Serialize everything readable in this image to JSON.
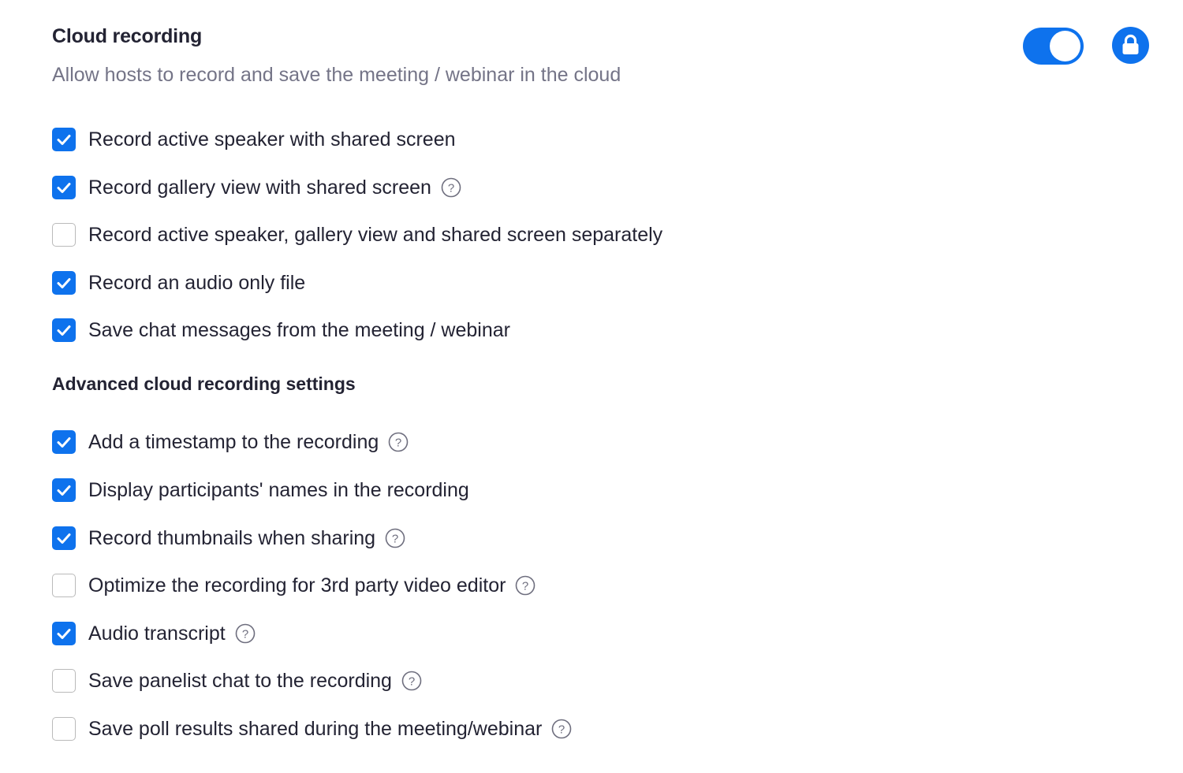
{
  "header": {
    "title": "Cloud recording",
    "description": "Allow hosts to record and save the meeting / webinar in the cloud",
    "toggle_on": true,
    "locked": true,
    "accent_color": "#0e72ed"
  },
  "options": [
    {
      "label": "Record active speaker with shared screen",
      "checked": true,
      "help": false
    },
    {
      "label": "Record gallery view with shared screen",
      "checked": true,
      "help": true
    },
    {
      "label": "Record active speaker, gallery view and shared screen separately",
      "checked": false,
      "help": false
    },
    {
      "label": "Record an audio only file",
      "checked": true,
      "help": false
    },
    {
      "label": "Save chat messages from the meeting / webinar",
      "checked": true,
      "help": false
    }
  ],
  "advanced": {
    "title": "Advanced cloud recording settings",
    "options": [
      {
        "label": "Add a timestamp to the recording",
        "checked": true,
        "help": true
      },
      {
        "label": "Display participants' names in the recording",
        "checked": true,
        "help": false
      },
      {
        "label": "Record thumbnails when sharing",
        "checked": true,
        "help": true
      },
      {
        "label": "Optimize the recording for 3rd party video editor",
        "checked": false,
        "help": true
      },
      {
        "label": "Audio transcript",
        "checked": true,
        "help": true
      },
      {
        "label": "Save panelist chat to the recording",
        "checked": false,
        "help": true
      },
      {
        "label": "Save poll results shared during the meeting/webinar",
        "checked": false,
        "help": true
      }
    ]
  },
  "icons": {
    "toggle": "toggle-switch-icon",
    "lock": "lock-icon",
    "checkbox": "checkmark-icon",
    "help": "question-circle-icon"
  }
}
